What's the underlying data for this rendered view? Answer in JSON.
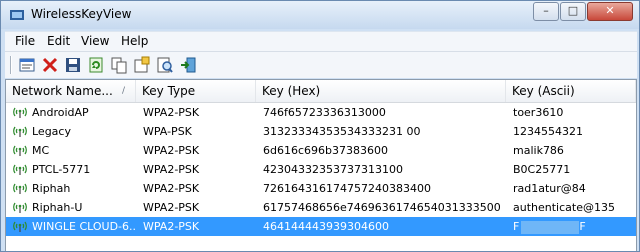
{
  "window": {
    "title": "WirelessKeyView",
    "minimize": "–",
    "maximize": "□",
    "close": "✕"
  },
  "menu": [
    "File",
    "Edit",
    "View",
    "Help"
  ],
  "toolbar": [
    "properties-icon",
    "delete-icon",
    "save-icon",
    "refresh-icon",
    "copy-icon",
    "export-icon",
    "find-icon",
    "exit-icon"
  ],
  "columns": [
    "Network Name...",
    "Key Type",
    "Key (Hex)",
    "Key (Ascii)"
  ],
  "sort_indicator": "/",
  "rows": [
    {
      "name": "AndroidAP",
      "type": "WPA2-PSK",
      "hex": "746f65723336313000",
      "ascii": "toer3610"
    },
    {
      "name": "Legacy",
      "type": "WPA-PSK",
      "hex": "31323334353534333231 00",
      "ascii": "1234554321"
    },
    {
      "name": "MC",
      "type": "WPA2-PSK",
      "hex": "6d616c696b37383600",
      "ascii": "malik786"
    },
    {
      "name": "PTCL-5771",
      "type": "WPA2-PSK",
      "hex": "42304332353737313100",
      "ascii": "B0C25771"
    },
    {
      "name": "Riphah",
      "type": "WPA2-PSK",
      "hex": "726164316174757240383400",
      "ascii": "rad1atur@84"
    },
    {
      "name": "Riphah-U",
      "type": "WPA2-PSK",
      "hex": "61757468656e7469636174654031333500",
      "ascii": "authenticate@135"
    },
    {
      "name": "WINGLE CLOUD-6...",
      "type": "WPA2-PSK",
      "hex": "464144443939304600",
      "ascii": "F",
      "ascii_end": "F"
    }
  ]
}
